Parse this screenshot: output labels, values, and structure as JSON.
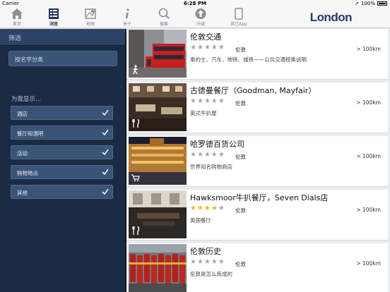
{
  "status": {
    "carrier": "Carrier",
    "time": "6:28 PM",
    "battery": "100%"
  },
  "toolbar": {
    "tabs": [
      {
        "label": "首页",
        "icon": "home-icon"
      },
      {
        "label": "浏览",
        "icon": "list-icon"
      },
      {
        "label": "地图",
        "icon": "map-icon"
      },
      {
        "label": "关于",
        "icon": "info-icon"
      },
      {
        "label": "搜索",
        "icon": "search-icon"
      },
      {
        "label": "升级",
        "icon": "upgrade-icon"
      },
      {
        "label": "其它App",
        "icon": "device-icon"
      }
    ],
    "active_tab": "浏览",
    "brand": "London"
  },
  "sidebar": {
    "title": "筛选",
    "search_label": "按名字分类",
    "heading": "为我显示...",
    "filters": [
      {
        "label": "酒店",
        "checked": true
      },
      {
        "label": "餐厅和酒吧",
        "checked": true
      },
      {
        "label": "活动",
        "checked": true
      },
      {
        "label": "购物地点",
        "checked": true
      },
      {
        "label": "其他",
        "checked": true
      }
    ]
  },
  "list": {
    "items": [
      {
        "name": "伦敦交通",
        "rating": 0,
        "city": "伦敦",
        "distance": "> 100km",
        "description": "乘的士、汽车、地铁、城铁——公共交通搭乘说明",
        "category_icon": "walking-person-icon"
      },
      {
        "name": "古德曼餐厅（Goodman, Mayfair）",
        "rating": 0,
        "city": "伦敦",
        "distance": "> 100km",
        "description": "英式牛扒屋",
        "category_icon": "fork-knife-icon"
      },
      {
        "name": "哈罗德百货公司",
        "rating": 0,
        "city": "伦敦",
        "distance": "> 100km",
        "description": "世界知名购物商店",
        "category_icon": "shopping-cart-icon"
      },
      {
        "name": "Hawksmoor牛扒餐厅，Seven Dials店",
        "rating": 4,
        "city": "伦敦",
        "distance": "> 100km",
        "description": "英国餐厅",
        "category_icon": "fork-knife-icon"
      },
      {
        "name": "伦敦历史",
        "rating": 0,
        "city": "伦敦",
        "distance": "> 100km",
        "description": "伦敦是怎么炼成的",
        "category_icon": ""
      }
    ],
    "max_rating": 5
  },
  "colors": {
    "sidebar": "#1b2b44",
    "accent": "#243e63",
    "star_on": "#f2b21c",
    "star_off": "#a8a8a8"
  }
}
